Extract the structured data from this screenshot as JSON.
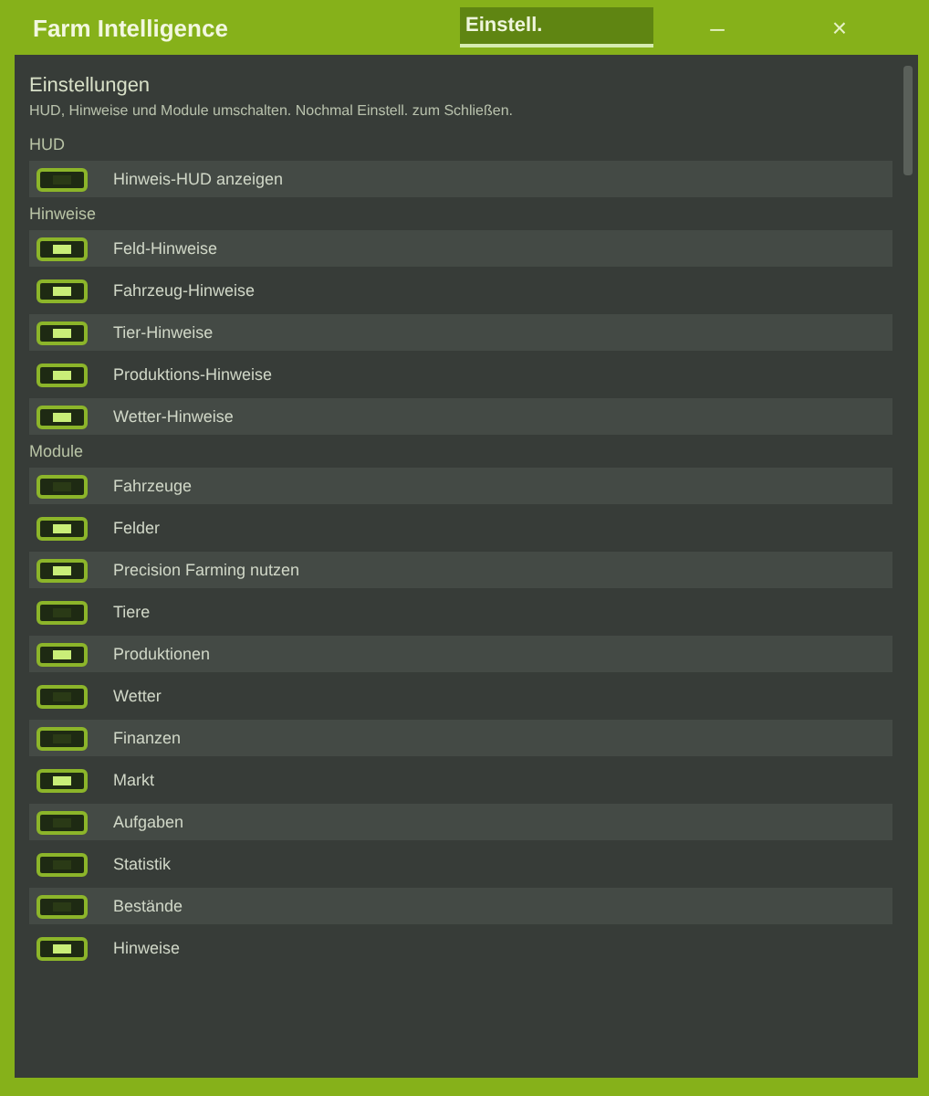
{
  "window": {
    "title": "Farm Intelligence",
    "tab": {
      "label": "Einstell.",
      "selected": true
    },
    "minimize": "–",
    "close": "×"
  },
  "settings": {
    "heading": "Einstellungen",
    "description": "HUD, Hinweise und Module umschalten. Nochmal Einstell. zum Schließen.",
    "sections": [
      {
        "title": "HUD",
        "items": [
          {
            "label": "Hinweis-HUD anzeigen",
            "on": false
          }
        ]
      },
      {
        "title": "Hinweise",
        "items": [
          {
            "label": "Feld-Hinweise",
            "on": true
          },
          {
            "label": "Fahrzeug-Hinweise",
            "on": true
          },
          {
            "label": "Tier-Hinweise",
            "on": true
          },
          {
            "label": "Produktions-Hinweise",
            "on": true
          },
          {
            "label": "Wetter-Hinweise",
            "on": true
          }
        ]
      },
      {
        "title": "Module",
        "items": [
          {
            "label": "Fahrzeuge",
            "on": false
          },
          {
            "label": "Felder",
            "on": true
          },
          {
            "label": "Precision Farming nutzen",
            "on": true
          },
          {
            "label": "Tiere",
            "on": false
          },
          {
            "label": "Produktionen",
            "on": true
          },
          {
            "label": "Wetter",
            "on": false
          },
          {
            "label": "Finanzen",
            "on": false
          },
          {
            "label": "Markt",
            "on": true
          },
          {
            "label": "Aufgaben",
            "on": false
          },
          {
            "label": "Statistik",
            "on": false
          },
          {
            "label": "Bestände",
            "on": false
          },
          {
            "label": "Hinweise",
            "on": true
          }
        ]
      }
    ]
  }
}
